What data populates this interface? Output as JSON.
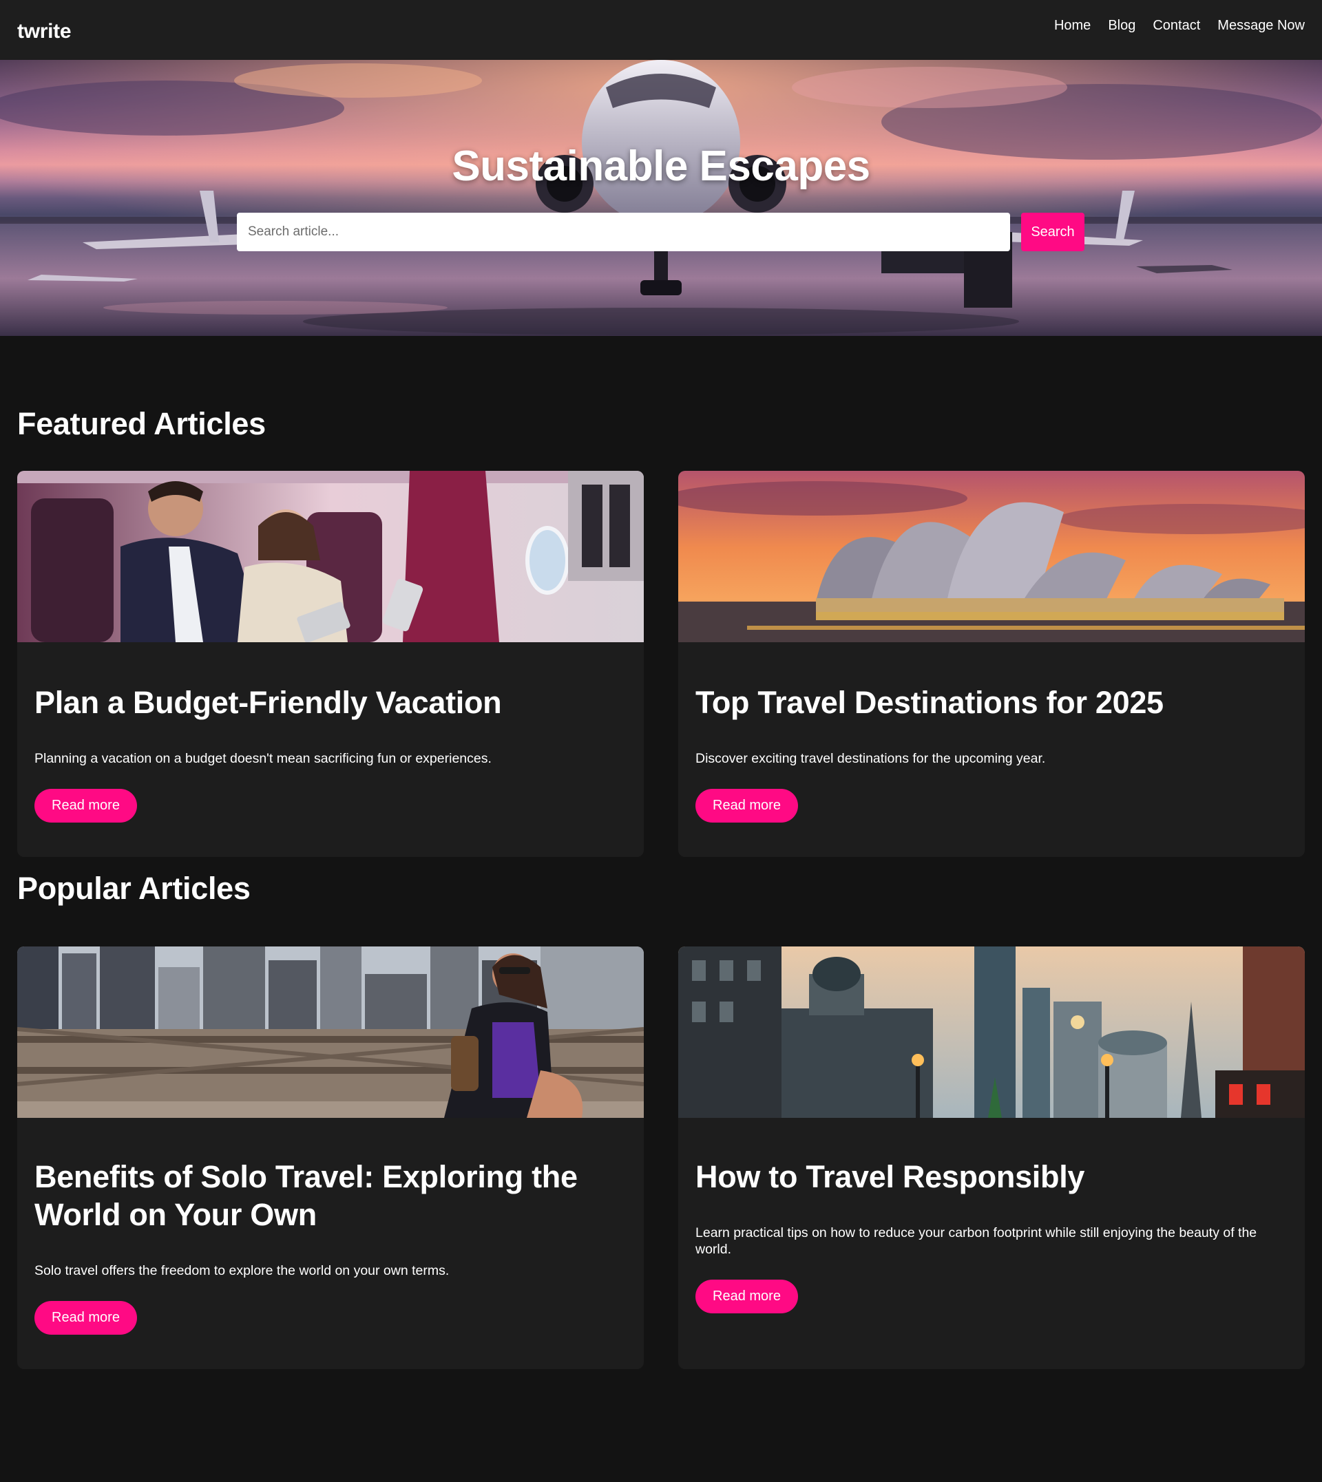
{
  "header": {
    "logo": "twrite",
    "nav": [
      {
        "label": "Home"
      },
      {
        "label": "Blog"
      },
      {
        "label": "Contact"
      },
      {
        "label": "Message Now"
      }
    ]
  },
  "hero": {
    "title": "Sustainable Escapes",
    "search_placeholder": "Search article...",
    "search_button": "Search"
  },
  "featured": {
    "heading": "Featured Articles",
    "articles": [
      {
        "title": "Plan a Budget-Friendly Vacation",
        "excerpt": "Planning a vacation on a budget doesn't mean sacrificing fun or experiences.",
        "cta": "Read more"
      },
      {
        "title": "Top Travel Destinations for 2025",
        "excerpt": "Discover exciting travel destinations for the upcoming year.",
        "cta": "Read more"
      }
    ]
  },
  "popular": {
    "heading": "Popular Articles",
    "articles": [
      {
        "title": "Benefits of Solo Travel: Exploring the World on Your Own",
        "excerpt": "Solo travel offers the freedom to explore the world on your own terms.",
        "cta": "Read more"
      },
      {
        "title": "How to Travel Responsibly",
        "excerpt": "Learn practical tips on how to reduce your carbon footprint while still enjoying the beauty of the world.",
        "cta": "Read more"
      }
    ]
  },
  "colors": {
    "accent": "#ff0a84",
    "page_background": "#131313",
    "surface": "#1d1d1d"
  }
}
